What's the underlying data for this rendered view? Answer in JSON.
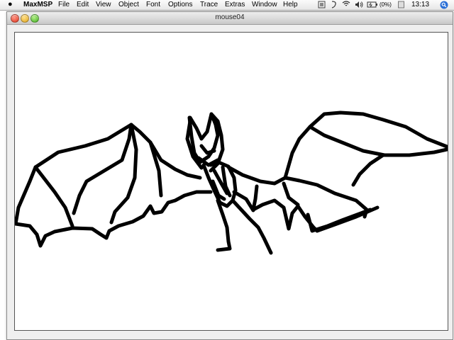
{
  "menubar": {
    "apple": "",
    "app_name": "MaxMSP",
    "items": [
      "File",
      "Edit",
      "View",
      "Object",
      "Font",
      "Options",
      "Trace",
      "Extras",
      "Window",
      "Help"
    ],
    "battery": "(0%)",
    "clock": "13:13",
    "tray_icons": [
      "window-icon",
      "script-icon",
      "bluetooth-icon",
      "wifi-icon",
      "volume-icon",
      "battery-icon"
    ]
  },
  "window": {
    "title": "mouse04"
  },
  "drawing": {
    "subject": "bat",
    "stroke_color": "#000000",
    "background": "#ffffff"
  }
}
